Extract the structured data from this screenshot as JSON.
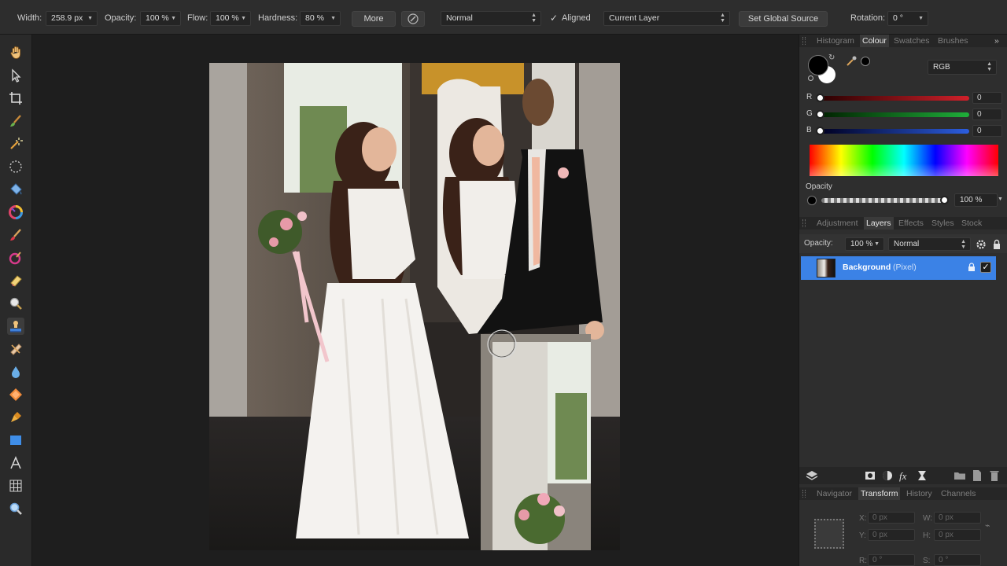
{
  "context_toolbar": {
    "width_label": "Width:",
    "width_value": "258.9 px",
    "opacity_label": "Opacity:",
    "opacity_value": "100 %",
    "flow_label": "Flow:",
    "flow_value": "100 %",
    "hardness_label": "Hardness:",
    "hardness_value": "80 %",
    "more_button": "More",
    "blend_mode": "Normal",
    "aligned_check": "✓",
    "aligned_label": "Aligned",
    "source_layer": "Current Layer",
    "global_source_button": "Set Global Source",
    "rotation_label": "Rotation:",
    "rotation_value": "0 °"
  },
  "tools": [
    {
      "name": "view-hand-tool",
      "icon": "hand-icon"
    },
    {
      "name": "move-tool",
      "icon": "arrow-pointer-icon"
    },
    {
      "name": "crop-tool",
      "icon": "crop-icon"
    },
    {
      "name": "selection-brush-tool",
      "icon": "selection-brush-icon"
    },
    {
      "name": "flood-select-tool",
      "icon": "magic-wand-icon"
    },
    {
      "name": "marquee-tool",
      "icon": "marquee-icon"
    },
    {
      "name": "flood-fill-tool",
      "icon": "paint-bucket-icon"
    },
    {
      "name": "color-picker-tool",
      "icon": "color-wheel-icon"
    },
    {
      "name": "paint-brush-tool",
      "icon": "brush-icon"
    },
    {
      "name": "color-replacement-tool",
      "icon": "color-replace-icon"
    },
    {
      "name": "erase-brush-tool",
      "icon": "eraser-icon"
    },
    {
      "name": "dodge-tool",
      "icon": "magnifier-dodge-icon"
    },
    {
      "name": "clone-brush-tool",
      "icon": "clone-stamp-icon"
    },
    {
      "name": "healing-tool",
      "icon": "bandage-icon"
    },
    {
      "name": "blur-tool",
      "icon": "droplet-icon"
    },
    {
      "name": "shape-tool",
      "icon": "diamond-icon"
    },
    {
      "name": "pen-tool",
      "icon": "pen-icon"
    },
    {
      "name": "rectangle-tool",
      "icon": "rectangle-icon"
    },
    {
      "name": "text-tool",
      "icon": "text-icon"
    },
    {
      "name": "mesh-warp-tool",
      "icon": "grid-icon"
    },
    {
      "name": "zoom-tool",
      "icon": "zoom-icon"
    }
  ],
  "colour_panel": {
    "tabs": [
      "Histogram",
      "Colour",
      "Swatches",
      "Brushes"
    ],
    "selected_tab": "Colour",
    "mode": "RGB",
    "channels": [
      {
        "label": "R",
        "value": "0",
        "color": "#d0202a"
      },
      {
        "label": "G",
        "value": "0",
        "color": "#1fae3a"
      },
      {
        "label": "B",
        "value": "0",
        "color": "#2c5ee0"
      }
    ],
    "opacity_label": "Opacity",
    "opacity_value": "100 %"
  },
  "layers_panel": {
    "tabs": [
      "Adjustment",
      "Layers",
      "Effects",
      "Styles",
      "Stock"
    ],
    "selected_tab": "Layers",
    "opacity_label": "Opacity:",
    "opacity_value": "100 %",
    "blend_mode": "Normal",
    "layers": [
      {
        "name": "Background",
        "type": "(Pixel)",
        "visible": true
      }
    ]
  },
  "transform_panel": {
    "tabs": [
      "Navigator",
      "Transform",
      "History",
      "Channels"
    ],
    "selected_tab": "Transform",
    "x_label": "X:",
    "x_value": "0 px",
    "y_label": "Y:",
    "y_value": "0 px",
    "w_label": "W:",
    "w_value": "0 px",
    "h_label": "H:",
    "h_value": "0 px",
    "r_label": "R:",
    "r_value": "0 °",
    "s_label": "S:",
    "s_value": "0 °"
  },
  "colors": {
    "accent": "#3b82e6",
    "panel_bg": "#2e2e2e",
    "toolbar_bg": "#2d2d2d"
  }
}
